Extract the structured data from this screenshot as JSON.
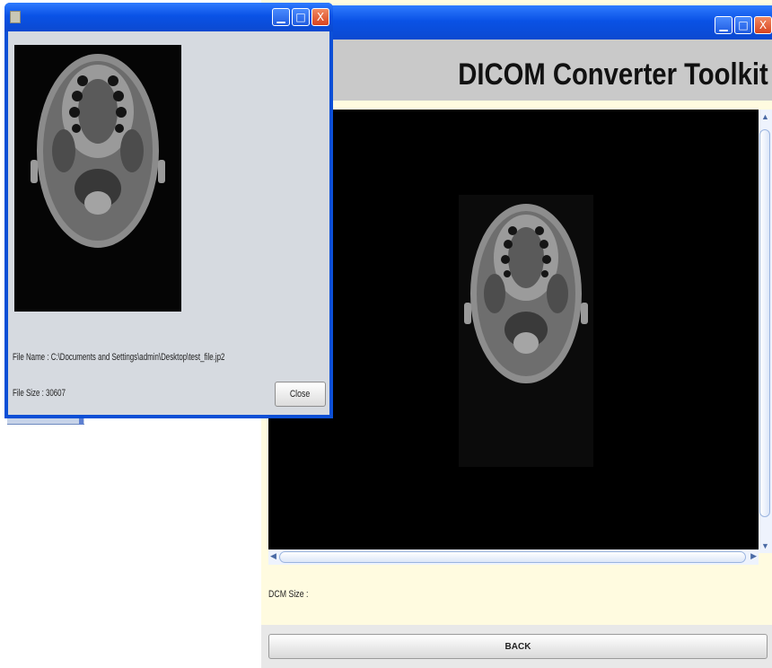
{
  "main_window": {
    "title_controls": [
      {
        "icon": "minimize-icon",
        "glyph": "▁"
      },
      {
        "icon": "maximize-icon",
        "glyph": "□"
      },
      {
        "icon": "close-icon",
        "glyph": "X"
      }
    ],
    "app_title": "DICOM Converter Toolkit",
    "dcm_size_label": "DCM Size :",
    "back_button": "BACK"
  },
  "dialog": {
    "title_controls": [
      {
        "icon": "minimize-icon",
        "glyph": "▁"
      },
      {
        "icon": "maximize-icon",
        "glyph": "□"
      },
      {
        "icon": "close-icon",
        "glyph": "X"
      }
    ],
    "file_name": "File Name : C:\\Documents and Settings\\admin\\Desktop\\test_file.jp2",
    "file_size": "File Size : 30607",
    "close_button": "Close"
  },
  "colors": {
    "titlebar": "#0a52e6",
    "close_red": "#d8431e",
    "panel_bg": "#fffbe0",
    "dialog_bg": "#d6dae0"
  }
}
